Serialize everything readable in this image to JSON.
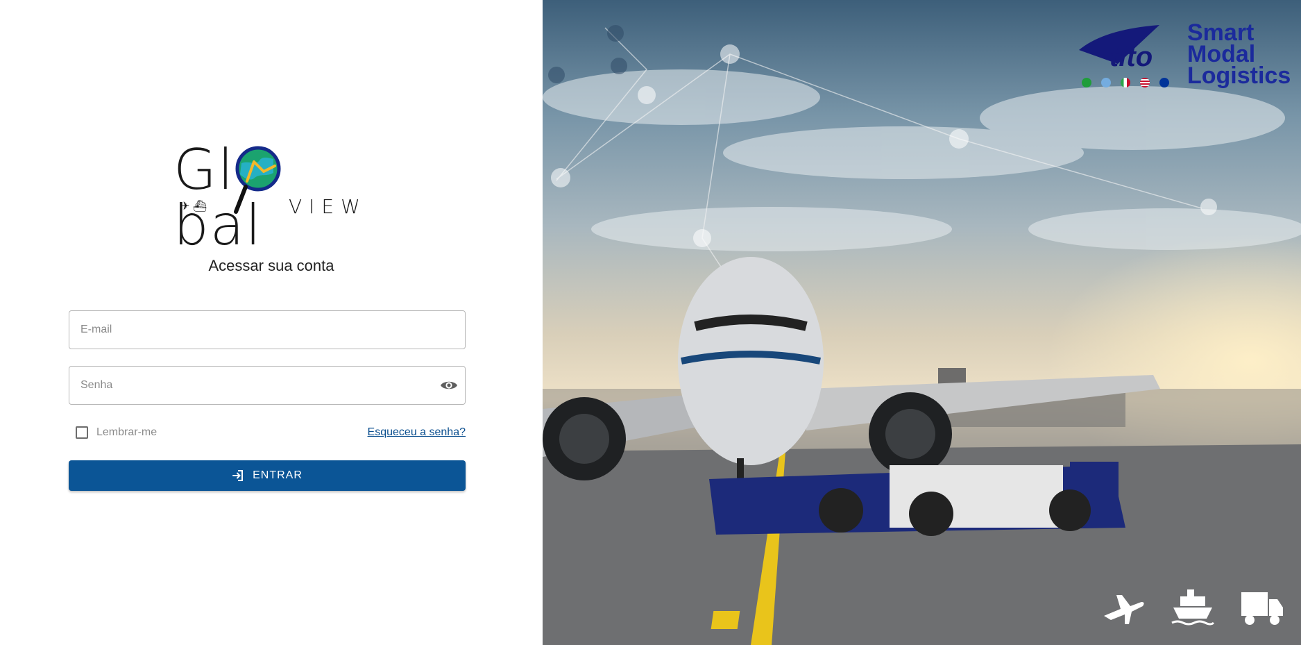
{
  "brand": {
    "logo_text": "Glbal",
    "logo_sub": "VIEW"
  },
  "login": {
    "title": "Acessar sua conta",
    "email_placeholder": "E-mail",
    "password_placeholder": "Senha",
    "remember_label": "Lembrar-me",
    "forgot_label": "Esqueceu a senha?",
    "submit_label": "ENTRAR"
  },
  "hero": {
    "company_lines": [
      "Smart",
      "Modal",
      "Logistics"
    ],
    "company_name": "tito",
    "flag_colors": [
      "#1f9d3a",
      "#74acdf",
      "#2aa54a",
      "#c8102e",
      "#003399"
    ],
    "transport_icons": [
      "airplane-icon",
      "ship-icon",
      "truck-icon"
    ]
  },
  "colors": {
    "primary": "#0b5596",
    "link": "#0b4f8f",
    "brand_blue": "#1b2a9c"
  }
}
